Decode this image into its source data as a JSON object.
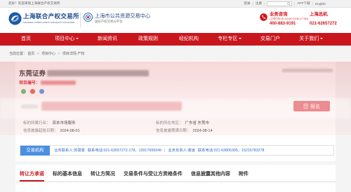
{
  "topbar": {
    "welcome": "您好！欢迎来到上海联合产权交易所",
    "login": "登录",
    "register": "注册",
    "separator": "|",
    "app_download": "APP下载",
    "english": "English"
  },
  "header": {
    "logo_name": "上海联合产权交易所",
    "logo_en": "SHANGHAI UNITED ASSETS AND EQUITY EXCHANGE",
    "platform_name": "上海市公共资源交易中心",
    "platform_sub": "国有产权交易分平台",
    "hotline": {
      "label": "业务咨询",
      "hours": "(工作日9:00-12:00 13:30-17:30)",
      "number": "400-883-9191"
    },
    "switchboard": {
      "label": "上海总机",
      "number": "021-62657272"
    }
  },
  "nav": {
    "items": [
      {
        "label": "首页"
      },
      {
        "label": "项目中心",
        "has_dropdown": true
      },
      {
        "label": "新闻资讯"
      },
      {
        "label": "政策规则"
      },
      {
        "label": "经纪机构"
      },
      {
        "label": "专栏专区",
        "has_dropdown": true
      },
      {
        "label": "交易门户"
      },
      {
        "label": "关于我们",
        "has_dropdown": true
      }
    ]
  },
  "breadcrumb": {
    "prefix": "当前位置：",
    "separator": ">",
    "items": [
      "首页",
      "项目中心",
      "项目详情-产权"
    ]
  },
  "project": {
    "title_visible": "东莞证券",
    "code_label": "项目编号：",
    "signup_button": "报名",
    "industry_label": "标的所属行业：",
    "industry": "资本市场服务",
    "region_label": "标的所在地区：",
    "region": "广东省 东莞市",
    "disclosure_start_label": "信息披露起始日期：",
    "disclosure_start": "2024-08-01",
    "disclosure_end_label": "信息披露期满日期：",
    "disclosure_end": "2024-08-14"
  },
  "agency": {
    "tab": "交易机构",
    "contact_person": "业务联系人:苏丽慧",
    "contact_phone": "联系电话:021-62657272-178，13917699349",
    "separator": "|",
    "manager": "业务负责人:谢凌",
    "manager_phone": "联系电话:021-63805305，15216783278"
  },
  "tabs": {
    "active_index": 0,
    "items": [
      "转让方承诺",
      "标的基本信息",
      "转让方简况",
      "交易条件与受让方资格条件",
      "信息披露其他内容",
      "附件"
    ]
  },
  "icons": {
    "search": "search-icon",
    "phone": "phone-icon",
    "dropdown": "chevron-down-icon",
    "signup": "document-icon",
    "share": "share-icon",
    "logo": "exchange-logo-icon",
    "platform": "platform-emblem-icon"
  },
  "colors": {
    "brand_red": "#c9161d",
    "logo_blue": "#1b4a8c",
    "agency_tab_blue": "#4a8fe0",
    "contact_text_blue": "#2b6cc4",
    "hotline_red": "#d0161e"
  }
}
